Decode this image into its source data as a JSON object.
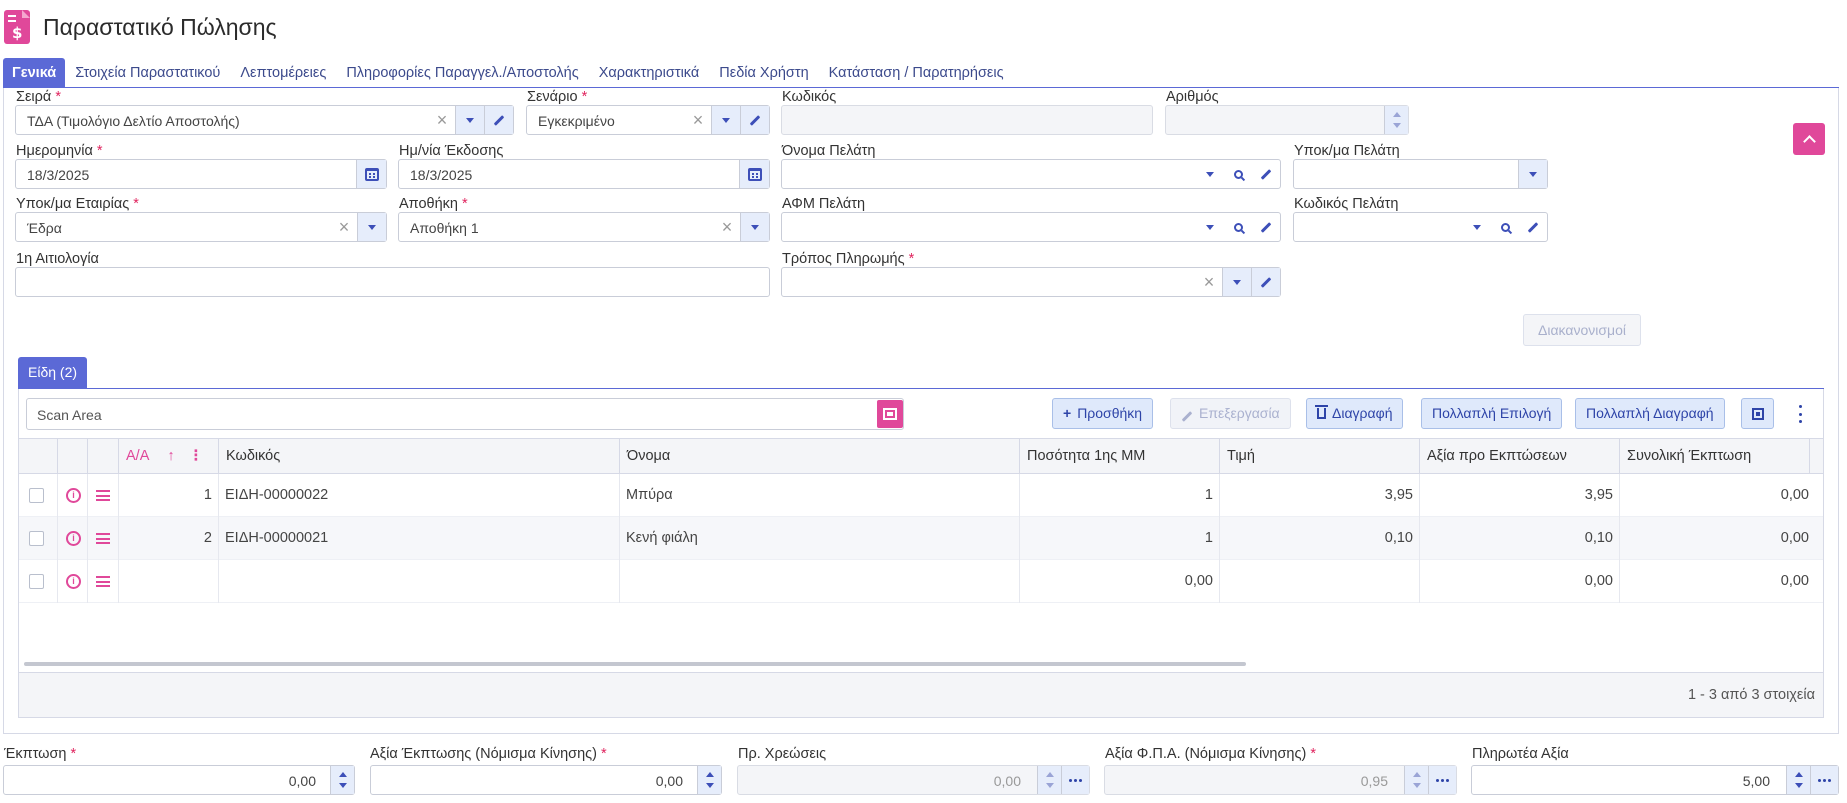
{
  "title": "Παραστατικό Πώλησης",
  "tabs": [
    "Γενικά",
    "Στοιχεία Παραστατικού",
    "Λεπτομέρειες",
    "Πληροφορίες Παραγγελ./Αποστολής",
    "Χαρακτηριστικά",
    "Πεδία Χρήστη",
    "Κατάσταση / Παρατηρήσεις"
  ],
  "form": {
    "series_label": "Σειρά",
    "series_value": "ΤΔΑ (Τιμολόγιο Δελτίο Αποστολής)",
    "scenario_label": "Σενάριο",
    "scenario_value": "Εγκεκριμένο",
    "code_label": "Κωδικός",
    "number_label": "Αριθμός",
    "date_label": "Ημερομηνία",
    "date_value": "18/3/2025",
    "issue_date_label": "Ημ/νία Έκδοσης",
    "issue_date_value": "18/3/2025",
    "customer_name_label": "Όνομα Πελάτη",
    "customer_branch_label": "Υποκ/μα Πελάτη",
    "company_branch_label": "Υποκ/μα Εταιρίας",
    "company_branch_value": "Έδρα",
    "warehouse_label": "Αποθήκη",
    "warehouse_value": "Αποθήκη 1",
    "customer_vat_label": "ΑΦΜ Πελάτη",
    "customer_code_label": "Κωδικός Πελάτη",
    "reason_label": "1η Αιτιολογία",
    "payment_label": "Τρόπος Πληρωμής",
    "settlements_button": "Διακανονισμοί",
    "required_mark": "*"
  },
  "items": {
    "tab_label": "Είδη (2)",
    "scan_placeholder": "Scan Area",
    "toolbar": {
      "add": "Προσθήκη",
      "edit": "Επεξεργασία",
      "delete": "Διαγραφή",
      "multi_select": "Πολλαπλή Επιλογή",
      "multi_delete": "Πολλαπλή Διαγραφή"
    },
    "columns": [
      "Α/Α",
      "Κωδικός",
      "Όνομα",
      "Ποσότητα 1ης ΜΜ",
      "Τιμή",
      "Αξία προ Εκπτώσεων",
      "Συνολική Έκπτωση"
    ],
    "rows": [
      {
        "aa": "1",
        "code": "ΕΙΔΗ-00000022",
        "name": "Μπύρα",
        "qty": "1",
        "price": "3,95",
        "value": "3,95",
        "discount": "0,00"
      },
      {
        "aa": "2",
        "code": "ΕΙΔΗ-00000021",
        "name": "Κενή φιάλη",
        "qty": "1",
        "price": "0,10",
        "value": "0,10",
        "discount": "0,00"
      },
      {
        "aa": "",
        "code": "",
        "name": "",
        "qty": "0,00",
        "price": "",
        "value": "0,00",
        "discount": "0,00"
      }
    ],
    "footer": "1 - 3 από 3 στοιχεία"
  },
  "totals": {
    "discount_label": "Έκπτωση",
    "discount_value": "0,00",
    "discount_amount_label": "Αξία Έκπτωσης (Νόμισμα Κίνησης)",
    "discount_amount_value": "0,00",
    "charges_label": "Πρ. Χρεώσεις",
    "charges_value": "0,00",
    "vat_label": "Αξία Φ.Π.Α. (Νόμισμα Κίνησης)",
    "vat_value": "0,95",
    "payable_label": "Πληρωτέα Αξία",
    "payable_value": "5,00"
  },
  "colors": {
    "accent": "#5b69d6",
    "pink": "#e0489a",
    "button_bg": "#dfe9fb"
  }
}
